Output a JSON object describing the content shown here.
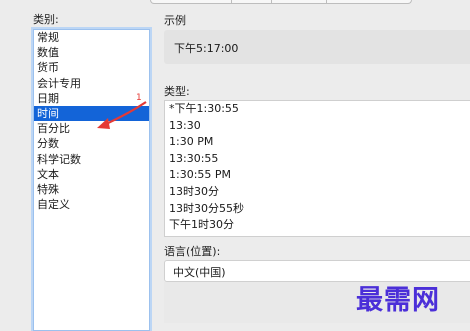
{
  "dialog": {
    "category_label": "类别:",
    "categories": [
      "常规",
      "数值",
      "货币",
      "会计专用",
      "日期",
      "时间",
      "百分比",
      "分数",
      "科学记数",
      "文本",
      "特殊",
      "自定义"
    ],
    "selected_category": "时间",
    "sample_label": "示例",
    "sample_value": "下午5:17:00",
    "type_label": "类型:",
    "types": [
      "*下午1:30:55",
      "13:30",
      "1:30 PM",
      "13:30:55",
      "1:30:55 PM",
      "13时30分",
      "13时30分55秒",
      "下午1时30分"
    ],
    "locale_label": "语言(位置):",
    "locale_value": "中文(中国)"
  },
  "annotation": {
    "step_number": "1",
    "arrow_color": "#e53935"
  },
  "watermark": {
    "text": "最需网",
    "color": "#4b2fd8"
  },
  "colors": {
    "selection": "#1364d8",
    "focus_ring": "#9cc1ee"
  }
}
